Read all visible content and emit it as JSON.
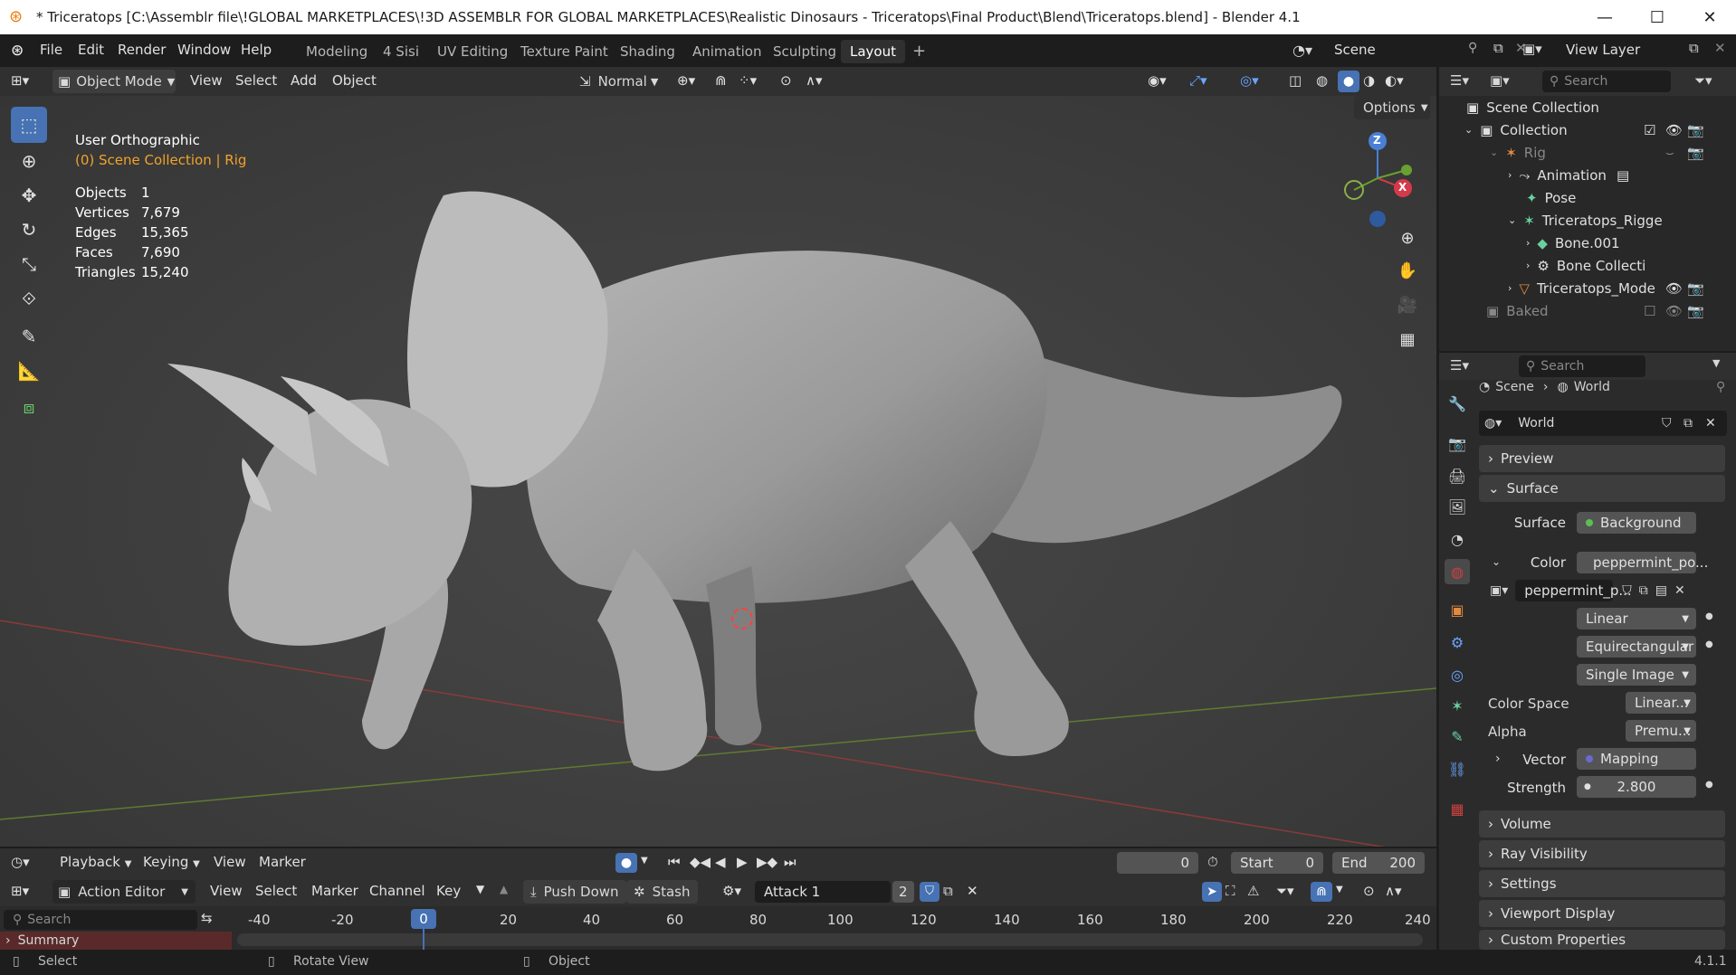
{
  "titlebar": {
    "title": "* Triceratops [C:\\Assemblr file\\!GLOBAL MARKETPLACES\\!3D ASSEMBLR FOR GLOBAL MARKETPLACES\\Realistic Dinosaurs - Triceratops\\Final Product\\Blend\\Triceratops.blend] - Blender 4.1",
    "minimize": "—",
    "maximize": "☐",
    "close": "✕"
  },
  "menubar": {
    "items": [
      "File",
      "Edit",
      "Render",
      "Window",
      "Help"
    ]
  },
  "workspaces": {
    "tabs": [
      "Modeling",
      "4 Sisi",
      "UV Editing",
      "Texture Paint",
      "Shading",
      "Animation",
      "Sculpting",
      "Layout"
    ],
    "active": "Layout",
    "add": "+"
  },
  "scene_selector": {
    "value": "Scene"
  },
  "view_layer_selector": {
    "value": "View Layer"
  },
  "viewport_header": {
    "mode": "Object Mode",
    "menus": [
      "View",
      "Select",
      "Add",
      "Object"
    ],
    "transform_orientation": "Normal",
    "options": "Options"
  },
  "viewport": {
    "view_name": "User Orthographic",
    "collection_path": "(0) Scene Collection | Rig",
    "stats": [
      {
        "label": "Objects",
        "value": "1"
      },
      {
        "label": "Vertices",
        "value": "7,679"
      },
      {
        "label": "Edges",
        "value": "15,365"
      },
      {
        "label": "Faces",
        "value": "7,690"
      },
      {
        "label": "Triangles",
        "value": "15,240"
      }
    ],
    "gizmo": {
      "z": "Z",
      "x": "X"
    }
  },
  "outliner": {
    "search_placeholder": "Search",
    "rows": [
      {
        "label": "Scene Collection"
      },
      {
        "label": "Collection"
      },
      {
        "label": "Rig"
      },
      {
        "label": "Animation"
      },
      {
        "label": "Pose"
      },
      {
        "label": "Triceratops_Rigge"
      },
      {
        "label": "Bone.001"
      },
      {
        "label": "Bone Collecti"
      },
      {
        "label": "Triceratops_Mode"
      },
      {
        "label": "Baked"
      }
    ]
  },
  "properties": {
    "search_placeholder": "Search",
    "breadcrumb": [
      "Scene",
      "World"
    ],
    "world_name": "World",
    "panels": {
      "preview": "Preview",
      "surface": "Surface",
      "volume": "Volume",
      "ray_visibility": "Ray Visibility",
      "settings": "Settings",
      "viewport_display": "Viewport Display",
      "custom_properties": "Custom Properties"
    },
    "surface_label": "Surface",
    "surface_value": "Background",
    "color_label": "Color",
    "color_value": "peppermint_po...",
    "image_name": "peppermint_p...",
    "interpolation": "Linear",
    "projection": "Equirectangular",
    "source": "Single Image",
    "color_space_label": "Color Space",
    "color_space_value": "Linear...",
    "alpha_label": "Alpha",
    "alpha_value": "Premu...",
    "vector_label": "Vector",
    "vector_value": "Mapping",
    "strength_label": "Strength",
    "strength_value": "2.800",
    "version": "4.1.1"
  },
  "timeline": {
    "menus": [
      "Playback",
      "Keying",
      "View",
      "Marker"
    ],
    "current_frame": "0",
    "start_label": "Start",
    "start_value": "0",
    "end_label": "End",
    "end_value": "200"
  },
  "action_editor": {
    "mode": "Action Editor",
    "menus": [
      "View",
      "Select",
      "Marker",
      "Channel",
      "Key"
    ],
    "push_down": "Push Down",
    "stash": "Stash",
    "action_name": "Attack 1",
    "users": "2",
    "search_placeholder": "Search",
    "summary": "Summary",
    "ticks": [
      "-40",
      "-20",
      "0",
      "20",
      "40",
      "60",
      "80",
      "100",
      "120",
      "140",
      "160",
      "180",
      "200",
      "220",
      "240"
    ],
    "current": "0"
  },
  "statusbar": {
    "items": [
      "Select",
      "Rotate View",
      "Object"
    ]
  },
  "colors": {
    "accent": "#4772b3",
    "selected_orange": "#f2a22a",
    "summary_bg": "#5a2a2a"
  }
}
